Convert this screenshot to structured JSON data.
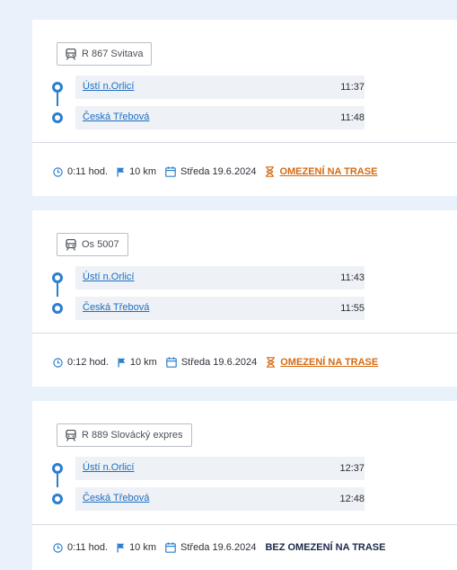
{
  "connections": [
    {
      "train": "R 867 Svitava",
      "from": {
        "name": "Ústí n.Orlicí",
        "time": "11:37"
      },
      "to": {
        "name": "Česká Třebová",
        "time": "11:48"
      },
      "duration": "0:11 hod.",
      "distance": "10 km",
      "date": "Středa 19.6.2024",
      "restriction": "OMEZENÍ NA TRASE"
    },
    {
      "train": "Os 5007",
      "from": {
        "name": "Ústí n.Orlicí",
        "time": "11:43"
      },
      "to": {
        "name": "Česká Třebová",
        "time": "11:55"
      },
      "duration": "0:12 hod.",
      "distance": "10 km",
      "date": "Středa 19.6.2024",
      "restriction": "OMEZENÍ NA TRASE"
    },
    {
      "train": "R 889 Slovácký expres",
      "from": {
        "name": "Ústí n.Orlicí",
        "time": "12:37"
      },
      "to": {
        "name": "Česká Třebová",
        "time": "12:48"
      },
      "duration": "0:11 hod.",
      "distance": "10 km",
      "date": "Středa 19.6.2024",
      "restriction": "BEZ OMEZENÍ NA TRASE"
    }
  ],
  "colors": {
    "accent": "#2c7fcd",
    "warning": "#d56a12",
    "ok": "#1b2a48"
  }
}
